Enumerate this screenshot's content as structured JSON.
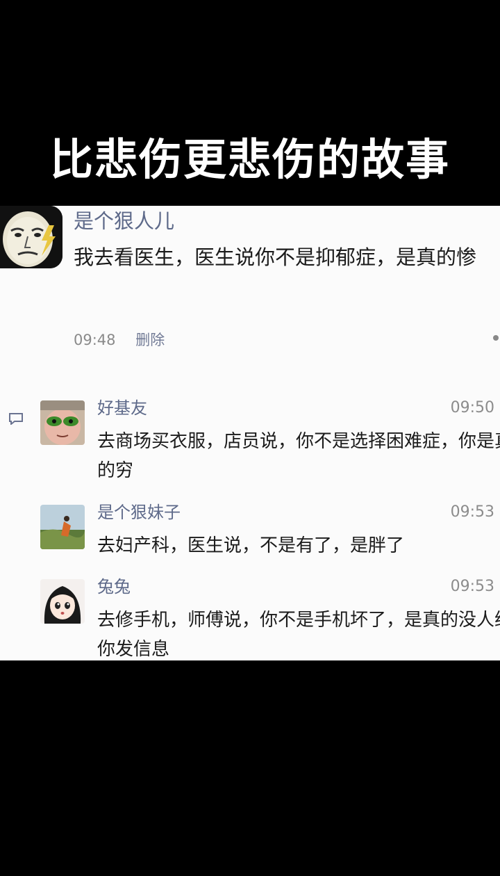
{
  "video_title": "比悲伤更悲伤的故事",
  "post": {
    "author": "是个狠人儿",
    "text": "我去看医生，医生说你不是抑郁症，是真的惨",
    "time": "09:48",
    "delete_label": "删除"
  },
  "comments": [
    {
      "name": "好基友",
      "time": "09:50",
      "text": "去商场买衣服，店员说，你不是选择困难症，你是真的穷"
    },
    {
      "name": "是个狠妹子",
      "time": "09:53",
      "text": "去妇产科，医生说，不是有了，是胖了"
    },
    {
      "name": "兔兔",
      "time": "09:53",
      "text": "去修手机，师傅说，你不是手机坏了，是真的没人给你发信息"
    }
  ],
  "icons": {
    "comment": "comment-icon",
    "more": "more-icon"
  },
  "colors": {
    "name_blue": "#5e6a8a",
    "background": "#000000",
    "card": "#fbfbfb"
  }
}
